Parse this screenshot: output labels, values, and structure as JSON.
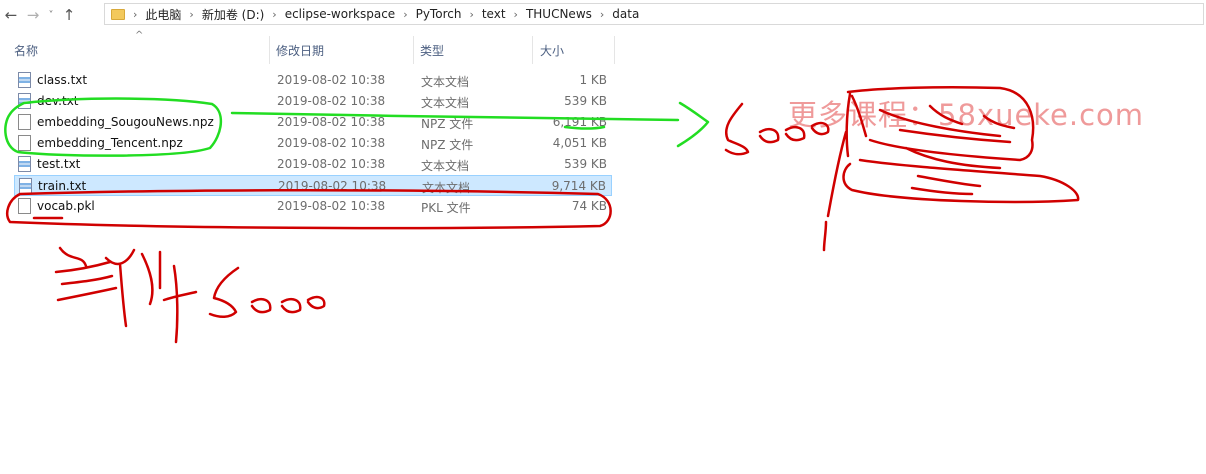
{
  "navigation": {
    "back_glyph": "←",
    "forward_glyph": "→",
    "recent_glyph": "˅",
    "up_glyph": "↑",
    "breadcrumbs": [
      "此电脑",
      "新加卷 (D:)",
      "eclipse-workspace",
      "PyTorch",
      "text",
      "THUCNews",
      "data"
    ],
    "separator": "›"
  },
  "columns": {
    "name": "名称",
    "date": "修改日期",
    "type": "类型",
    "size": "大小",
    "sort_glyph": "^"
  },
  "files": [
    {
      "name": "class.txt",
      "date": "2019-08-02 10:38",
      "type": "文本文档",
      "size": "1 KB",
      "icon": "text-file-icon"
    },
    {
      "name": "dev.txt",
      "date": "2019-08-02 10:38",
      "type": "文本文档",
      "size": "539 KB",
      "icon": "text-file-icon"
    },
    {
      "name": "embedding_SougouNews.npz",
      "date": "2019-08-02 10:38",
      "type": "NPZ 文件",
      "size": "6,191 KB",
      "icon": "file-icon"
    },
    {
      "name": "embedding_Tencent.npz",
      "date": "2019-08-02 10:38",
      "type": "NPZ 文件",
      "size": "4,051 KB",
      "icon": "file-icon"
    },
    {
      "name": "test.txt",
      "date": "2019-08-02 10:38",
      "type": "文本文档",
      "size": "539 KB",
      "icon": "text-file-icon"
    },
    {
      "name": "train.txt",
      "date": "2019-08-02 10:38",
      "type": "文本文档",
      "size": "9,714 KB",
      "icon": "text-file-icon",
      "selected": true
    },
    {
      "name": "vocab.pkl",
      "date": "2019-08-02 10:38",
      "type": "PKL 文件",
      "size": "74 KB",
      "icon": "file-icon"
    }
  ],
  "watermark": "更多课程：58xueke.com",
  "colors": {
    "red_ink": "#d00000",
    "green_ink": "#22dd22",
    "selection_fill": "#cde8ff",
    "selection_border": "#99d1ff",
    "header_text": "#4d6082"
  }
}
